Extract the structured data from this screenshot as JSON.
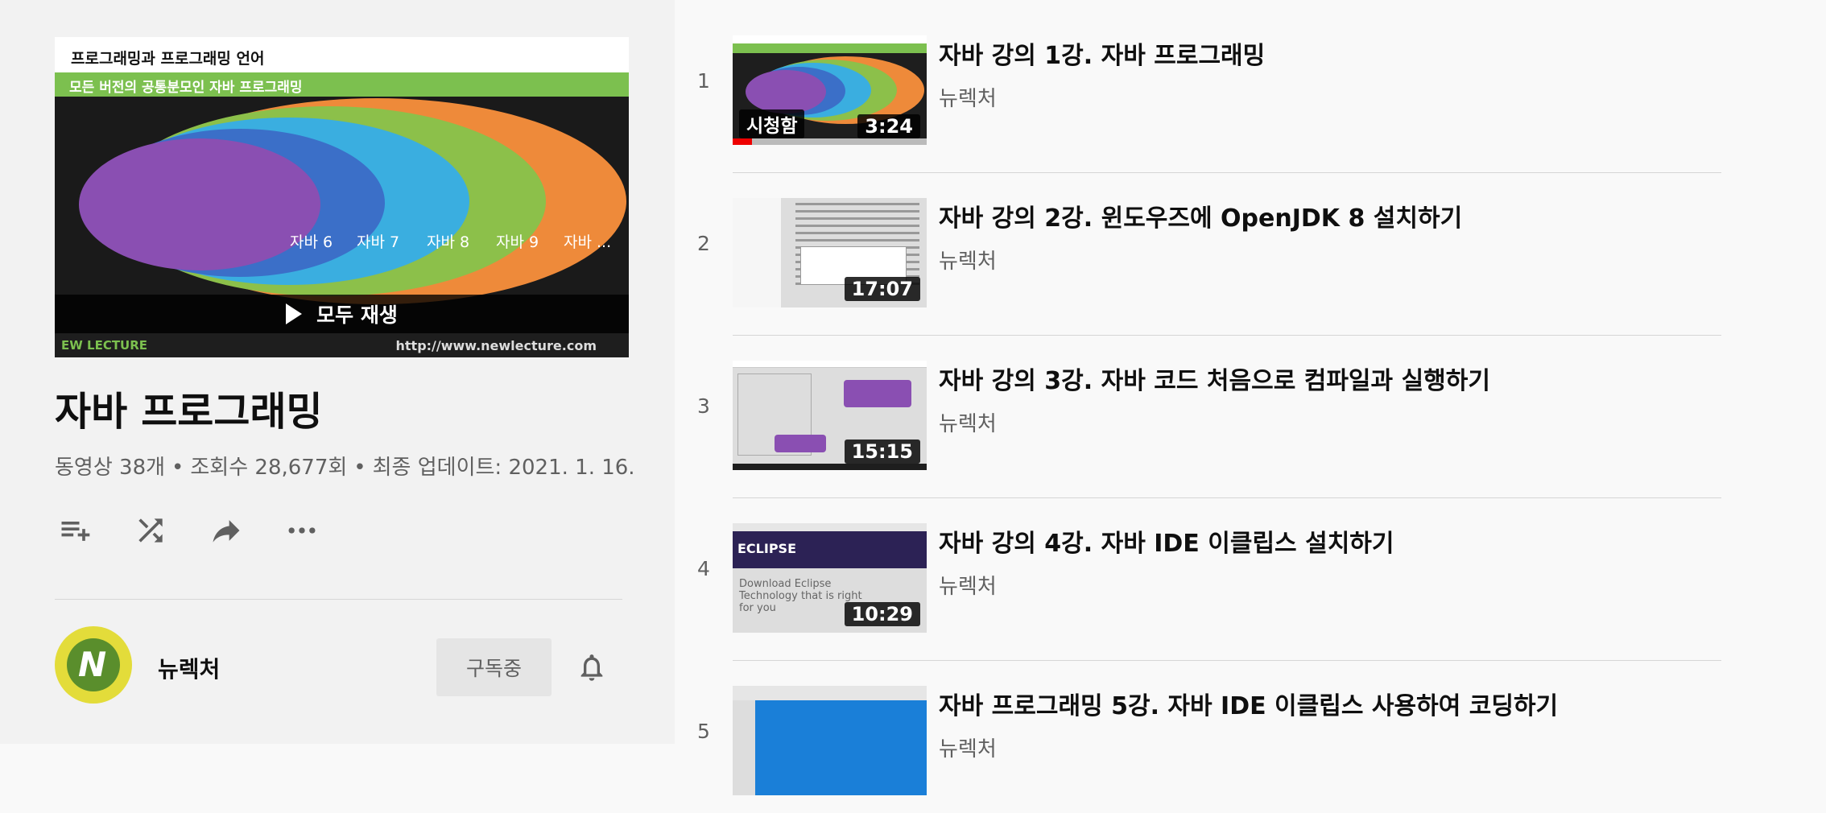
{
  "colors": {
    "accent_green": "#7cc04f",
    "progress_red": "#e00000"
  },
  "hero": {
    "slide_title": "프로그래밍과 프로그래밍 언어",
    "slide_subtitle": "모든 버전의 공통분모인 자바 프로그래밍",
    "ellipse_labels": [
      "자바 6",
      "자바 7",
      "자바 8",
      "자바 9",
      "자바 ..."
    ],
    "brand": "EW LECTURE",
    "url": "http://www.newlecture.com",
    "play_all_label": "모두 재생"
  },
  "playlist": {
    "title": "자바 프로그래밍",
    "video_count": "동영상 38개",
    "views": "조회수 28,677회",
    "updated": "최종 업데이트: 2021. 1. 16.",
    "separator": "•"
  },
  "actions": [
    "add-to-queue-icon",
    "shuffle-icon",
    "share-icon",
    "more-icon"
  ],
  "channel": {
    "name": "뉴렉처",
    "avatar_letter": "N",
    "subscribe_label": "구독중"
  },
  "videos": [
    {
      "index": "1",
      "title": "자바 강의 1강. 자바 프로그래밍",
      "channel": "뉴렉처",
      "duration": "3:24",
      "watched_label": "시청함",
      "progress": 0.1
    },
    {
      "index": "2",
      "title": "자바 강의 2강. 윈도우즈에 OpenJDK 8 설치하기",
      "channel": "뉴렉처",
      "duration": "17:07"
    },
    {
      "index": "3",
      "title": "자바 강의 3강. 자바 코드 처음으로 컴파일과 실행하기",
      "channel": "뉴렉처",
      "duration": "15:15"
    },
    {
      "index": "4",
      "title": "자바 강의 4강. 자바 IDE 이클립스 설치하기",
      "channel": "뉴렉처",
      "duration": "10:29",
      "thumb_logo": "ECLIPSE",
      "thumb_text": "Download Eclipse Technology that is right for you"
    },
    {
      "index": "5",
      "title": "자바 프로그래밍 5강. 자바 IDE 이클립스 사용하여 코딩하기",
      "channel": "뉴렉처"
    }
  ]
}
